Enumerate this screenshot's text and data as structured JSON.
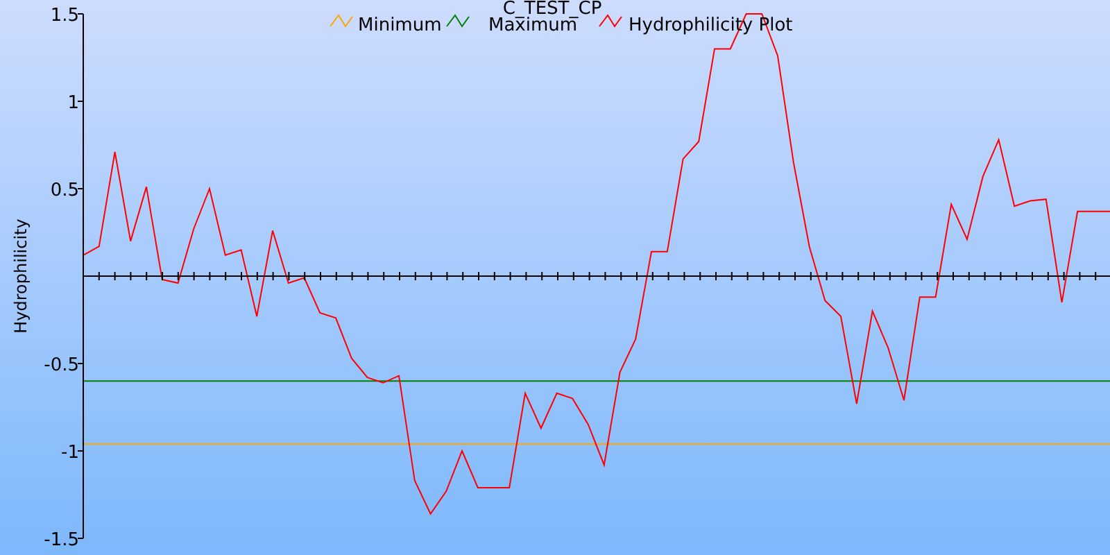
{
  "chart_data": {
    "type": "line",
    "title": "C_TEST_CP",
    "legend": true,
    "ylabel": "Hydrophilicity",
    "ylim": [
      -1.5,
      1.5
    ],
    "yticks": [
      {
        "value": -1.5,
        "label": "-1.5"
      },
      {
        "value": -1,
        "label": "-1"
      },
      {
        "value": -0.5,
        "label": "-0.5"
      },
      {
        "value": 0.5,
        "label": "0.5"
      },
      {
        "value": 1,
        "label": "1"
      },
      {
        "value": 1.5,
        "label": "1.5"
      }
    ],
    "series": [
      {
        "name": "Minimum",
        "color": "#ffa500",
        "values": [
          -0.96,
          -0.96,
          -0.96,
          -0.96,
          -0.96,
          -0.96,
          -0.96,
          -0.96,
          -0.96,
          -0.96,
          -0.96,
          -0.96,
          -0.96,
          -0.96,
          -0.96,
          -0.96,
          -0.96,
          -0.96,
          -0.96,
          -0.96,
          -0.96,
          -0.96,
          -0.96,
          -0.96,
          -0.96,
          -0.96,
          -0.96,
          -0.96,
          -0.96,
          -0.96,
          -0.96,
          -0.96,
          -0.96,
          -0.96,
          -0.96,
          -0.96,
          -0.96,
          -0.96,
          -0.96,
          -0.96,
          -0.96,
          -0.96,
          -0.96,
          -0.96,
          -0.96,
          -0.96,
          -0.96,
          -0.96,
          -0.96,
          -0.96,
          -0.96,
          -0.96,
          -0.96,
          -0.96,
          -0.96,
          -0.96,
          -0.96,
          -0.96,
          -0.96,
          -0.96,
          -0.96,
          -0.96,
          -0.96,
          -0.96,
          -0.96,
          -0.96
        ]
      },
      {
        "name": "Maximum",
        "color": "#008000",
        "values": [
          -0.6,
          -0.6,
          -0.6,
          -0.6,
          -0.6,
          -0.6,
          -0.6,
          -0.6,
          -0.6,
          -0.6,
          -0.6,
          -0.6,
          -0.6,
          -0.6,
          -0.6,
          -0.6,
          -0.6,
          -0.6,
          -0.6,
          -0.6,
          -0.6,
          -0.6,
          -0.6,
          -0.6,
          -0.6,
          -0.6,
          -0.6,
          -0.6,
          -0.6,
          -0.6,
          -0.6,
          -0.6,
          -0.6,
          -0.6,
          -0.6,
          -0.6,
          -0.6,
          -0.6,
          -0.6,
          -0.6,
          -0.6,
          -0.6,
          -0.6,
          -0.6,
          -0.6,
          -0.6,
          -0.6,
          -0.6,
          -0.6,
          -0.6,
          -0.6,
          -0.6,
          -0.6,
          -0.6,
          -0.6,
          -0.6,
          -0.6,
          -0.6,
          -0.6,
          -0.6,
          -0.6,
          -0.6,
          -0.6,
          -0.6,
          -0.6,
          -0.6
        ]
      },
      {
        "name": "Hydrophilicity Plot",
        "color": "#ff0000",
        "values": [
          0.12,
          0.17,
          0.71,
          0.2,
          0.51,
          -0.02,
          -0.04,
          0.27,
          0.5,
          0.12,
          0.15,
          -0.23,
          0.26,
          -0.04,
          -0.01,
          -0.21,
          -0.24,
          -0.47,
          -0.58,
          -0.61,
          -0.57,
          -1.17,
          -1.36,
          -1.23,
          -1.0,
          -1.21,
          -1.21,
          -1.21,
          -0.67,
          -0.87,
          -0.67,
          -0.7,
          -0.85,
          -1.08,
          -0.55,
          -0.36,
          0.14,
          0.14,
          0.67,
          0.77,
          1.3,
          1.3,
          1.5,
          1.5,
          1.26,
          0.65,
          0.17,
          -0.14,
          -0.23,
          -0.73,
          -0.2,
          -0.41,
          -0.71,
          -0.12,
          -0.12,
          0.41,
          0.21,
          0.57,
          0.78,
          0.4,
          0.43,
          0.44,
          -0.15,
          0.37,
          0.37,
          0.37
        ]
      }
    ]
  }
}
